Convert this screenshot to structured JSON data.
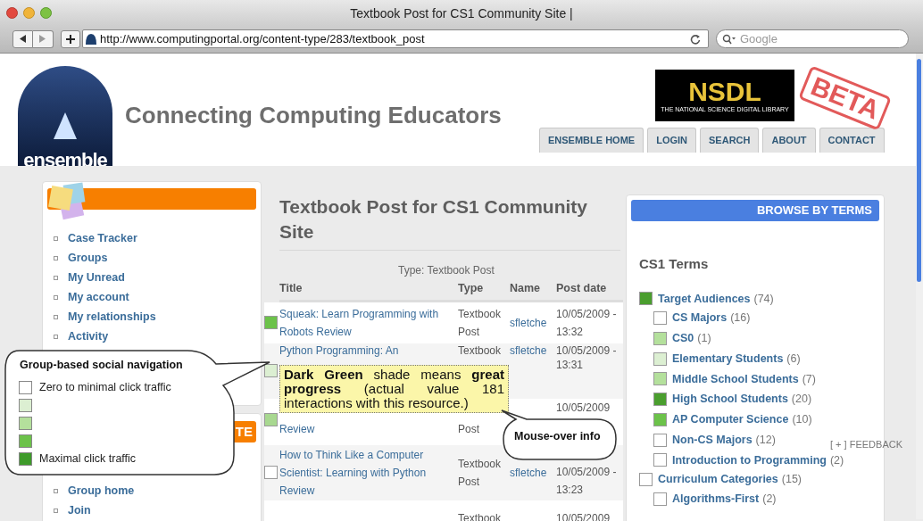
{
  "browser": {
    "title": "Textbook Post for CS1 Community Site |",
    "url": "http://www.computingportal.org/content-type/283/textbook_post",
    "search": {
      "placeholder": "Google"
    }
  },
  "site": {
    "logo_text": "ensemble",
    "heading": "Connecting Computing Educators",
    "nsdl": {
      "name": "NSDL",
      "tagline": "THE NATIONAL SCIENCE DIGITAL LIBRARY"
    },
    "stamp": "BETA",
    "tabs": [
      "ENSEMBLE HOME",
      "LOGIN",
      "SEARCH",
      "ABOUT",
      "CONTACT"
    ]
  },
  "left_sidebar": {
    "menu": [
      "Case Tracker",
      "Groups",
      "My Unread",
      "My account",
      "My relationships",
      "Activity"
    ],
    "section_header": "TE",
    "group_menu": [
      "Group home",
      "Join"
    ]
  },
  "content": {
    "title": "Textbook Post for CS1 Community Site",
    "caption": "Type: Textbook Post",
    "columns": [
      "Title",
      "Type",
      "Name",
      "Post date"
    ],
    "rows": [
      {
        "color": "#6cc24a",
        "title": "Squeak: Learn Programming with Robots Review",
        "type": "Textbook Post",
        "name": "sfletche",
        "date": "10/05/2009 - 13:32"
      },
      {
        "color": "#dcefd2",
        "title": "Python Programming:  An",
        "type": "Textbook",
        "name": "sfletche",
        "date": "10/05/2009 - 13:31"
      },
      {
        "color": "#a8d890",
        "title": "Review",
        "type": "Post",
        "date": "10/05/2009"
      },
      {
        "color": "#ffffff",
        "title": "How to Think Like a Computer Scientist: Learning with Python Review",
        "type": "Textbook Post",
        "name": "sfletche",
        "date": "10/05/2009 - 13:23"
      },
      {
        "type": "Textbook",
        "date": "10/05/2009"
      }
    ]
  },
  "right_sidebar": {
    "header": "BROWSE BY TERMS",
    "title": "CS1 Terms",
    "terms": [
      {
        "label": "Target Audiences",
        "count": "(74)",
        "color": "#4a9e2e",
        "children": [
          {
            "label": "CS Majors",
            "count": "(16)",
            "color": "#ffffff"
          },
          {
            "label": "CS0",
            "count": "(1)",
            "color": "#b4e09c"
          },
          {
            "label": "Elementary Students",
            "count": "(6)",
            "color": "#dcefd2"
          },
          {
            "label": "Middle School Students",
            "count": "(7)",
            "color": "#b4e09c"
          },
          {
            "label": "High School Students",
            "count": "(20)",
            "color": "#4a9e2e"
          },
          {
            "label": "AP Computer Science",
            "count": "(10)",
            "color": "#6cc24a"
          },
          {
            "label": "Non-CS Majors",
            "count": "(12)",
            "color": "#ffffff"
          },
          {
            "label": "Introduction to Programming",
            "count": "(2)",
            "color": "#ffffff"
          }
        ]
      },
      {
        "label": "Curriculum Categories",
        "count": "(15)",
        "color": "#ffffff",
        "children": [
          {
            "label": "Algorithms-First",
            "count": "(2)",
            "color": "#ffffff"
          }
        ]
      }
    ]
  },
  "feedback": "[ + ] FEEDBACK",
  "annotations": {
    "legend": {
      "title": "Group-based social navigation",
      "levels": [
        {
          "color": "#ffffff",
          "label": "Zero to minimal click traffic"
        },
        {
          "color": "#dcefd2"
        },
        {
          "color": "#b4e09c"
        },
        {
          "color": "#6cc24a"
        },
        {
          "color": "#3e9a2a",
          "label": "Maximal click traffic"
        }
      ]
    },
    "tooltip": "**Dark Green** shade means **great progress** (actual value 181 interactions with this resource.)",
    "callout": "Mouse-over info"
  }
}
